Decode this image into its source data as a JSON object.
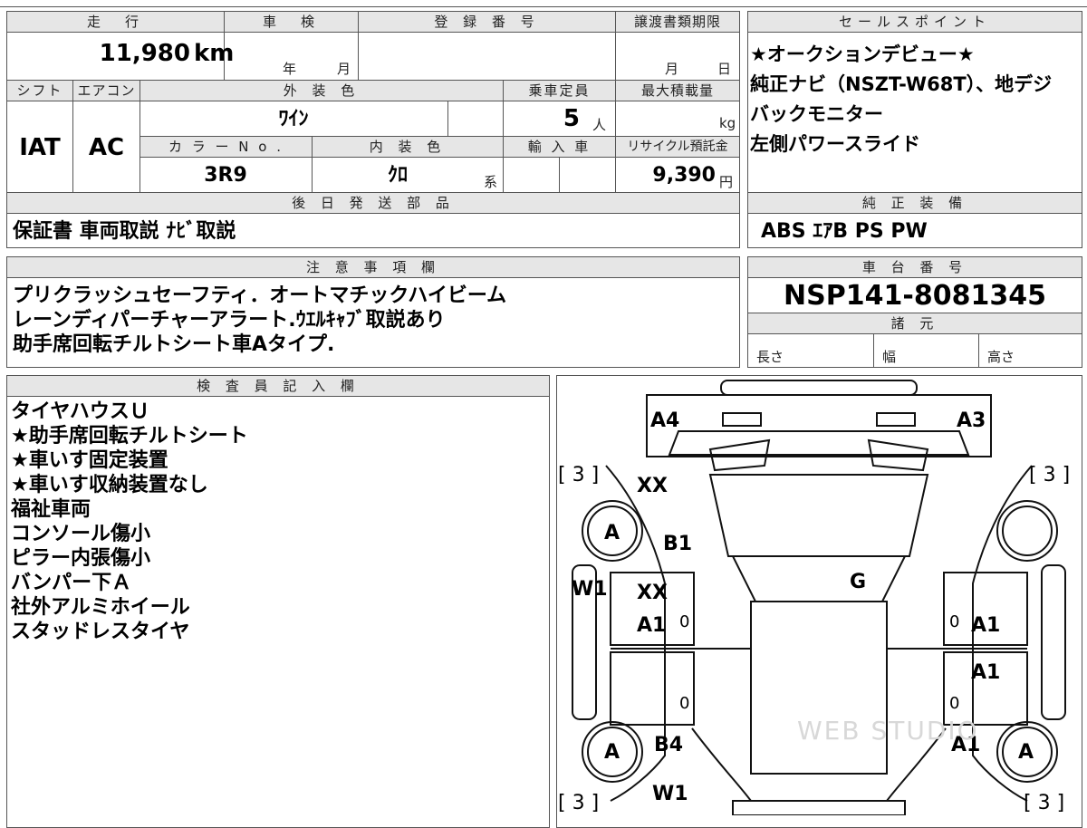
{
  "top_row": {
    "mileage_header": "走　行",
    "shaken_header": "車　検",
    "registration_header": "登 録 番 号",
    "transfer_header": "譲渡書類期限",
    "mileage_value": "11,980",
    "mileage_unit": "km",
    "shaken_year": "年",
    "shaken_month": "月",
    "transfer_month": "月",
    "transfer_day": "日"
  },
  "row2": {
    "shift_header": "シフト",
    "ac_header": "エアコン",
    "exterior_color_header": "外 装 色",
    "capacity_header": "乗車定員",
    "max_load_header": "最大積載量",
    "shift_value": "IAT",
    "ac_value": "AC",
    "exterior_color_value": "ﾜｲﾝ",
    "capacity_value": "5",
    "capacity_unit": "人",
    "max_load_unit": "kg",
    "color_no_header": "カ ラ ー N o .",
    "interior_color_header": "内 装 色",
    "import_header": "輸 入 車",
    "recycle_header": "リサイクル預託金",
    "color_no_value": "3R9",
    "interior_color_value": "ｸﾛ",
    "interior_color_suffix": "系",
    "recycle_value": "9,390",
    "recycle_unit": "円"
  },
  "later_parts": {
    "header": "後 日 発 送 部 品",
    "value": "保証書 車両取説 ﾅﾋﾞ取説"
  },
  "sales_points": {
    "header": "セールスポイント",
    "lines": [
      "★オークションデビュー★",
      "純正ナビ（NSZT-W68T）、地デジ",
      "バックモニター",
      "左側パワースライド"
    ]
  },
  "genuine_equipment": {
    "header": "純 正 装 備",
    "value": "ABS ｴｱB PS PW"
  },
  "notes": {
    "header": "注 意 事 項 欄",
    "lines": [
      "プリクラッシュセーフティ．オートマチックハイビーム",
      "レーンディパーチャーアラート.ｳｴﾙｷｬﾌﾞ取説あり",
      "助手席回転チルトシート車Aタイプ."
    ]
  },
  "chassis": {
    "header": "車 台 番 号",
    "value": "NSP141-8081345",
    "specs_header": "諸 元",
    "length_label": "長さ",
    "width_label": "幅",
    "height_label": "高さ"
  },
  "inspector": {
    "header": "検 査 員 記 入 欄",
    "lines": [
      "タイヤハウスＵ",
      "★助手席回転チルトシート",
      "★車いす固定装置",
      "★車いす収納装置なし",
      "福祉車両",
      "コンソール傷小",
      "ピラー内張傷小",
      "バンパー下Ａ",
      "社外アルミホイール",
      "スタッドレスタイヤ"
    ]
  },
  "diagram": {
    "marks": {
      "a4": "A4",
      "a3": "A3",
      "tire_tl": "[ 3 ]",
      "tire_tr": "[ 3 ]",
      "tire_bl": "[ 3 ]",
      "tire_br": "[ 3 ]",
      "xx1": "XX",
      "b1": "B1",
      "wheel_fl": "A",
      "w1_left": "W1",
      "xx2": "XX",
      "a1_left": "A1",
      "g": "G",
      "a1_right1": "A1",
      "a1_right2": "A1",
      "a1_right3": "A1",
      "b4": "B4",
      "wheel_rl": "A",
      "wheel_rr": "A",
      "w1_bottom": "W1",
      "zero1": "0",
      "zero2": "0",
      "zero3": "0",
      "zero4": "0"
    },
    "watermark": "WEB STUDIO"
  }
}
